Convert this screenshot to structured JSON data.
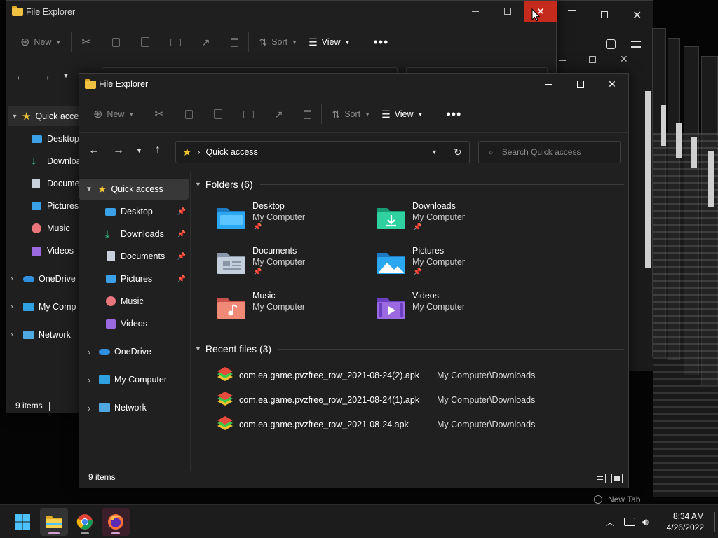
{
  "back_window": {
    "title": "File Explorer",
    "toolbar": {
      "new": "New",
      "sort": "Sort",
      "view": "View"
    },
    "nav": {
      "quick_access": "Quick acce",
      "desktop": "Desktop",
      "downloads": "Downloa",
      "documents": "Docume",
      "pictures": "Pictures",
      "music": "Music",
      "videos": "Videos",
      "onedrive": "OneDrive",
      "my_computer": "My Comp",
      "network": "Network"
    },
    "status": "9 items"
  },
  "main_window": {
    "title": "File Explorer",
    "toolbar": {
      "new": "New",
      "sort": "Sort",
      "view": "View"
    },
    "address": {
      "path": "Quick access"
    },
    "search": {
      "placeholder": "Search Quick access"
    },
    "nav": {
      "quick_access": "Quick access",
      "desktop": "Desktop",
      "downloads": "Downloads",
      "documents": "Documents",
      "pictures": "Pictures",
      "music": "Music",
      "videos": "Videos",
      "onedrive": "OneDrive",
      "my_computer": "My Computer",
      "network": "Network"
    },
    "folders_header": "Folders (6)",
    "folders": [
      {
        "name": "Desktop",
        "location": "My Computer",
        "pinned": true
      },
      {
        "name": "Downloads",
        "location": "My Computer",
        "pinned": true
      },
      {
        "name": "Documents",
        "location": "My Computer",
        "pinned": true
      },
      {
        "name": "Pictures",
        "location": "My Computer",
        "pinned": true
      },
      {
        "name": "Music",
        "location": "My Computer",
        "pinned": false
      },
      {
        "name": "Videos",
        "location": "My Computer",
        "pinned": false
      }
    ],
    "recent_header": "Recent files (3)",
    "recent_files": [
      {
        "name": "com.ea.game.pvzfree_row_2021-08-24(2).apk",
        "location": "My Computer\\Downloads"
      },
      {
        "name": "com.ea.game.pvzfree_row_2021-08-24(1).apk",
        "location": "My Computer\\Downloads"
      },
      {
        "name": "com.ea.game.pvzfree_row_2021-08-24.apk",
        "location": "My Computer\\Downloads"
      }
    ],
    "status": "9 items"
  },
  "background": {
    "browser_tab": "New Tab"
  },
  "taskbar": {
    "apps": [
      "start-icon",
      "file-explorer-icon",
      "chrome-icon",
      "firefox-icon"
    ],
    "time": "8:34 AM",
    "date": "4/26/2022"
  },
  "colors": {
    "window_bg": "#202020",
    "close_hover": "#c42b1c",
    "folder_yellow": "#f0c040",
    "accent_blue": "#4cc2ff"
  }
}
